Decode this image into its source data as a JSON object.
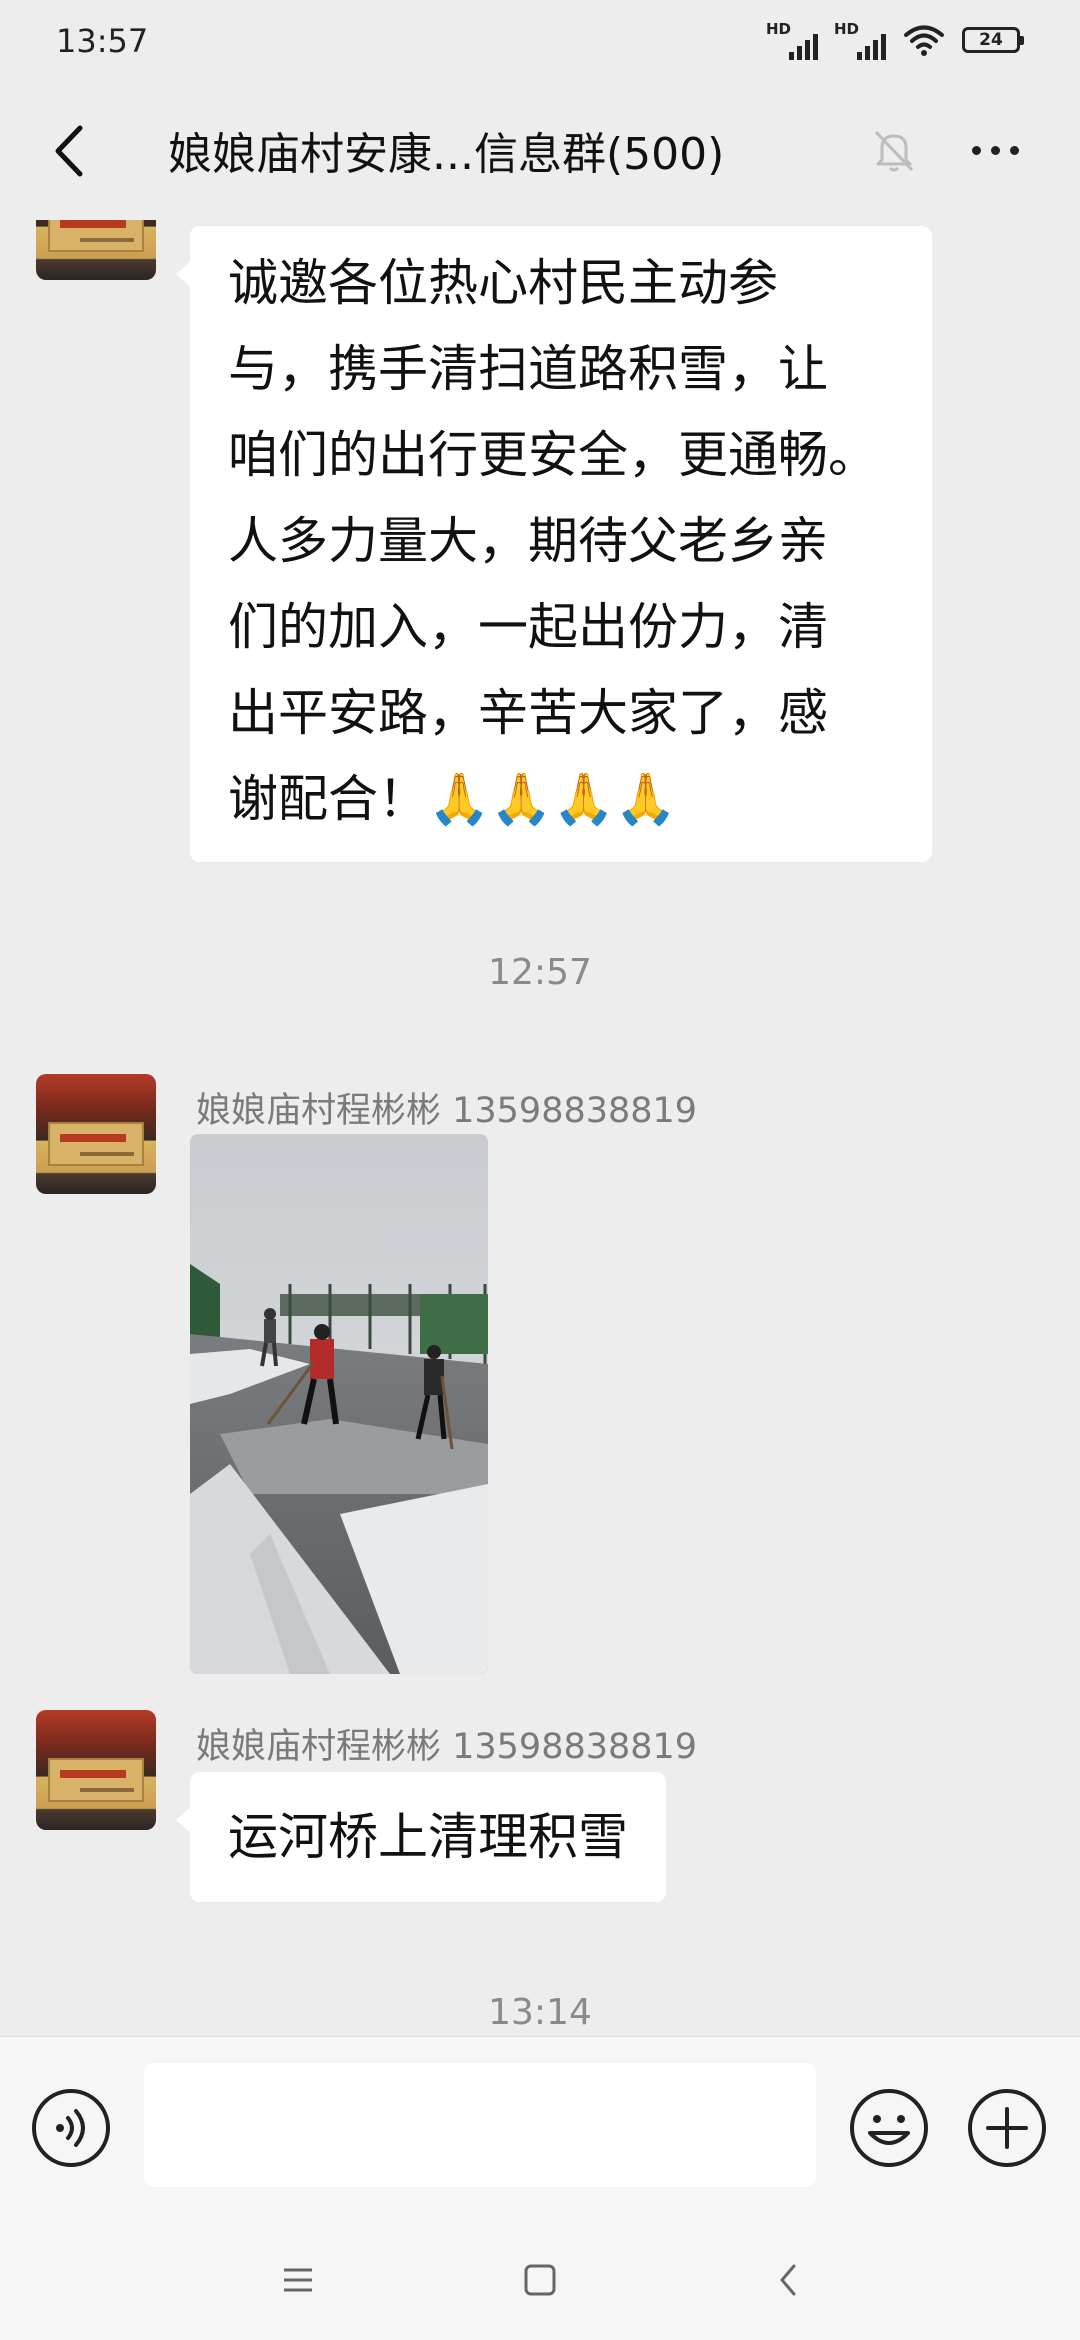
{
  "status_bar": {
    "time": "13:57",
    "signal1_label": "HD",
    "signal2_label": "HD",
    "battery": "24"
  },
  "header": {
    "title": "娘娘庙村安康...信息群(500)",
    "icons": {
      "back": "chevron-left-icon",
      "mute": "bell-off-icon",
      "more": "more-dots-icon"
    }
  },
  "messages": {
    "first_text": "诚邀各位热心村民主动参与，携手清扫道路积雪，让咱们的出行更安全，更通畅。人多力量大，期待父老乡亲们的加入，一起出份力，清出平安路，辛苦大家了，感谢配合！",
    "first_text_lines": [
      "诚邀各位热心村民主动参",
      "与，携手清扫道路积雪，让",
      "咱们的出行更安全，更通畅。",
      "人多力量大，期待父老乡亲",
      "们的加入，一起出份力，清",
      "出平安路，辛苦大家了，感",
      "谢配合！🙏🙏🙏🙏"
    ],
    "time_1": "12:57",
    "sender_1": "娘娘庙村程彬彬 13598838819",
    "photo_subject": "villagers sweeping snow on a bridge road",
    "sender_2": "娘娘庙村程彬彬 13598838819",
    "text_2": "运河桥上清理积雪",
    "time_2": "13:14"
  },
  "input_bar": {
    "placeholder": "",
    "icons": {
      "voice": "voice-icon",
      "emoji": "emoji-icon",
      "plus": "plus-icon"
    }
  },
  "nav_bar": {
    "icons": {
      "menu": "menu-icon",
      "home": "home-icon",
      "back": "back-icon"
    }
  },
  "colors": {
    "background": "#EDEDED",
    "bubble": "#FFFFFF",
    "meta_text": "#8A8A8A"
  }
}
